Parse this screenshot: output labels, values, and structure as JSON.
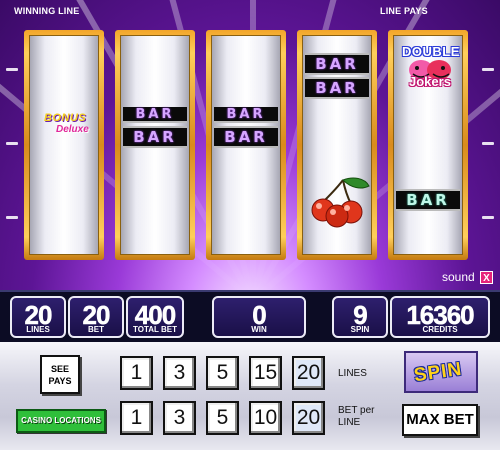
{
  "header": {
    "winning_line_label": "WINNING LINE",
    "line_pays_label": "LINE PAYS"
  },
  "reels": {
    "symbols": [
      "BAR",
      "BONUS",
      "Deluxe",
      "DOUBLE",
      "Jokers"
    ]
  },
  "sound": {
    "label": "sound",
    "close_glyph": "X"
  },
  "counters": {
    "lines": {
      "value": "20",
      "label": "LINES"
    },
    "bet": {
      "value": "20",
      "label": "BET"
    },
    "total_bet": {
      "value": "400",
      "label": "TOTAL BET"
    },
    "win": {
      "value": "0",
      "label": "WIN"
    },
    "spin": {
      "value": "9",
      "label": "SPIN"
    },
    "credits": {
      "value": "16360",
      "label": "CREDITS"
    }
  },
  "controls": {
    "see_pays": "SEE PAYS",
    "casino_locations": "CASINO LOCATIONS",
    "lines_label": "LINES",
    "bet_per_line_label_1": "BET per",
    "bet_per_line_label_2": "LINE",
    "lines_options": [
      "1",
      "3",
      "5",
      "15",
      "20"
    ],
    "bet_options": [
      "1",
      "3",
      "5",
      "10",
      "20"
    ],
    "selected_lines": "20",
    "selected_bet": "20",
    "spin_label": "SPIN",
    "max_bet_label": "MAX BET"
  },
  "colors": {
    "background": "#5a1a8c",
    "reel_frame": "#f2a52a",
    "counter_bg": "#1a1048",
    "casino_button": "#2fbf3a",
    "sound_close": "#e6247a"
  }
}
